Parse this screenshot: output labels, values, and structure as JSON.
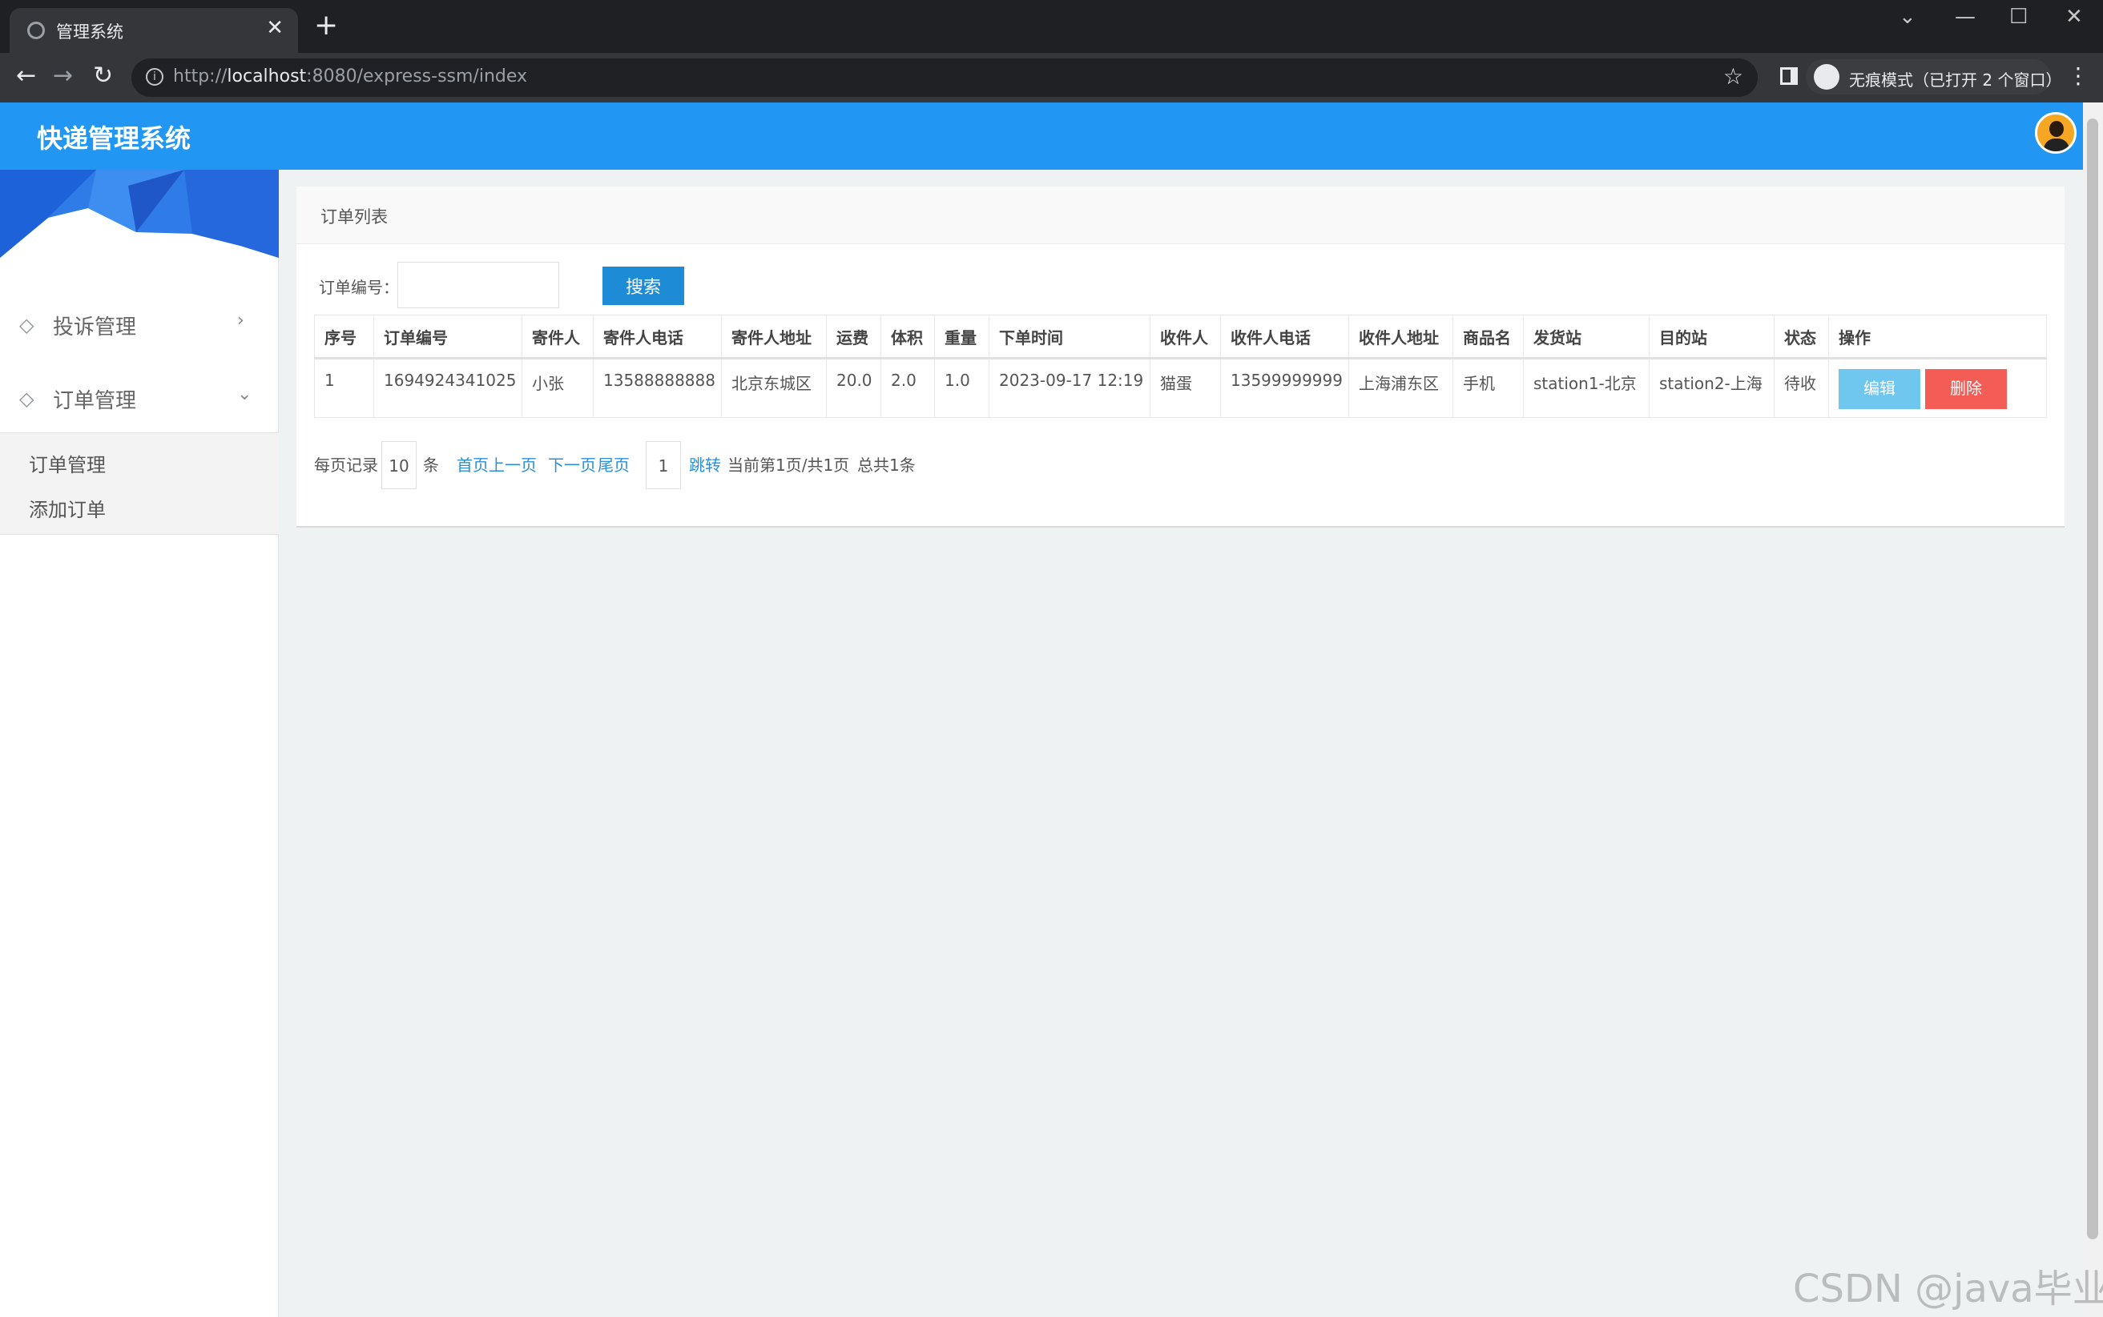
{
  "browser": {
    "tab_title": "管理系统",
    "tab_close": "✕",
    "new_tab": "+",
    "url_prefix": "http://",
    "url_host": "localhost",
    "url_rest": ":8080/express-ssm/index",
    "incognito_text": "无痕模式（已打开 2 个窗口）",
    "win_dropdown": "⌄",
    "win_minimize": "—",
    "win_maximize": "☐",
    "win_close": "✕"
  },
  "app": {
    "title": "快递管理系统"
  },
  "sidebar": {
    "items": [
      {
        "label": "投诉管理",
        "chevron": "›"
      },
      {
        "label": "订单管理",
        "chevron": "⌄"
      }
    ],
    "subitems": [
      {
        "label": "订单管理"
      },
      {
        "label": "添加订单"
      }
    ]
  },
  "panel": {
    "title": "订单列表",
    "search_label": "订单编号：",
    "search_value": "",
    "search_button": "搜索"
  },
  "table": {
    "headers": [
      "序号",
      "订单编号",
      "寄件人",
      "寄件人电话",
      "寄件人地址",
      "运费",
      "体积",
      "重量",
      "下单时间",
      "收件人",
      "收件人电话",
      "收件人地址",
      "商品名",
      "发货站",
      "目的站",
      "状态",
      "操作"
    ],
    "rows": [
      {
        "cells": [
          "1",
          "1694924341025",
          "小张",
          "13588888888",
          "北京东城区",
          "20.0",
          "2.0",
          "1.0",
          "2023-09-17 12:19",
          "猫蛋",
          "13599999999",
          "上海浦东区",
          "手机",
          "station1-北京",
          "station2-上海",
          "待收"
        ],
        "edit_label": "编辑",
        "delete_label": "删除"
      }
    ]
  },
  "pager": {
    "per_page_label": "每页记录",
    "per_page_value": "10",
    "unit": "条",
    "first": "首页",
    "prev": "上一页",
    "next": "下一页",
    "last": "尾页",
    "jump_value": "1",
    "jump": "跳转",
    "status": "当前第1页/共1页",
    "total": "总共1条"
  },
  "watermark": "CSDN @java毕业",
  "colors": {
    "header": "#2196f3",
    "search_button": "#1e8bd6",
    "edit_button": "#6fc6ee",
    "delete_button": "#f35d56",
    "link": "#2b8fd8"
  }
}
